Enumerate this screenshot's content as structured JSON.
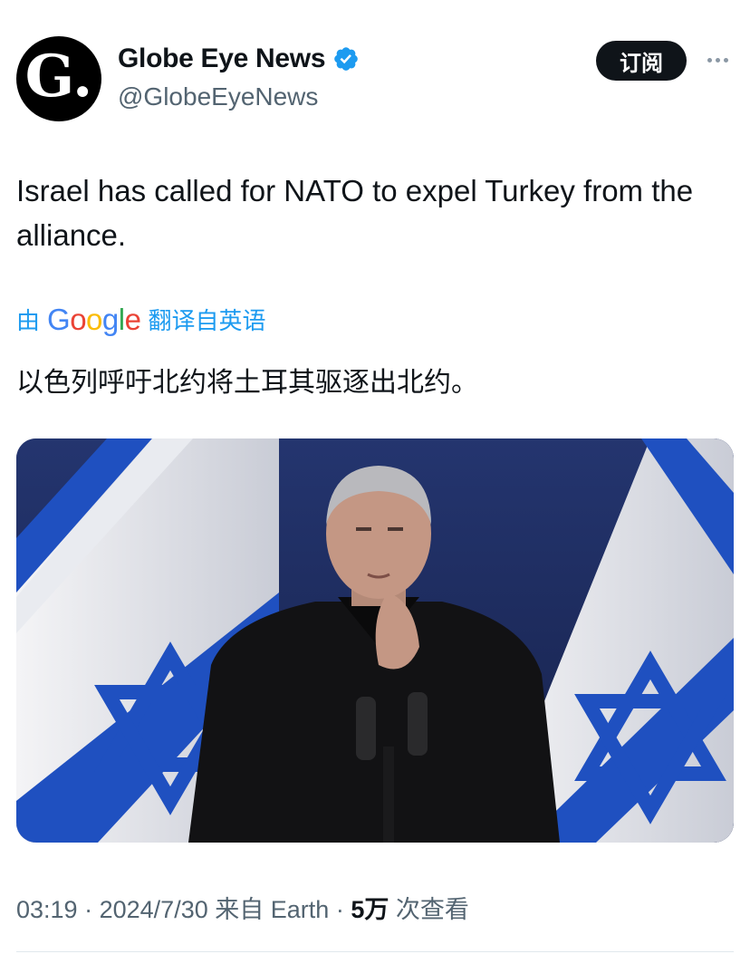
{
  "author": {
    "display_name": "Globe Eye News",
    "handle": "@GlobeEyeNews",
    "avatar_letter": "G.",
    "verified_icon": "verified-badge-icon"
  },
  "actions": {
    "subscribe_label": "订阅",
    "more_icon": "more-options-icon"
  },
  "tweet": {
    "text": "Israel has called for NATO to expel Turkey from the alliance.",
    "translation_prefix": "由",
    "translation_provider": "Google",
    "translation_suffix": "翻译自英语",
    "translated_text": "以色列呼吁北约将土耳其驱逐出北约。"
  },
  "media": {
    "type": "photo"
  },
  "meta": {
    "time": "03:19",
    "date": "2024/7/30",
    "source": "来自 Earth",
    "views_count": "5万",
    "views_label": "次查看",
    "separator": "·"
  },
  "colors": {
    "link": "#1d9bf0",
    "text": "#0f1419",
    "secondary": "#536471",
    "flag_blue": "#1f50c0"
  }
}
